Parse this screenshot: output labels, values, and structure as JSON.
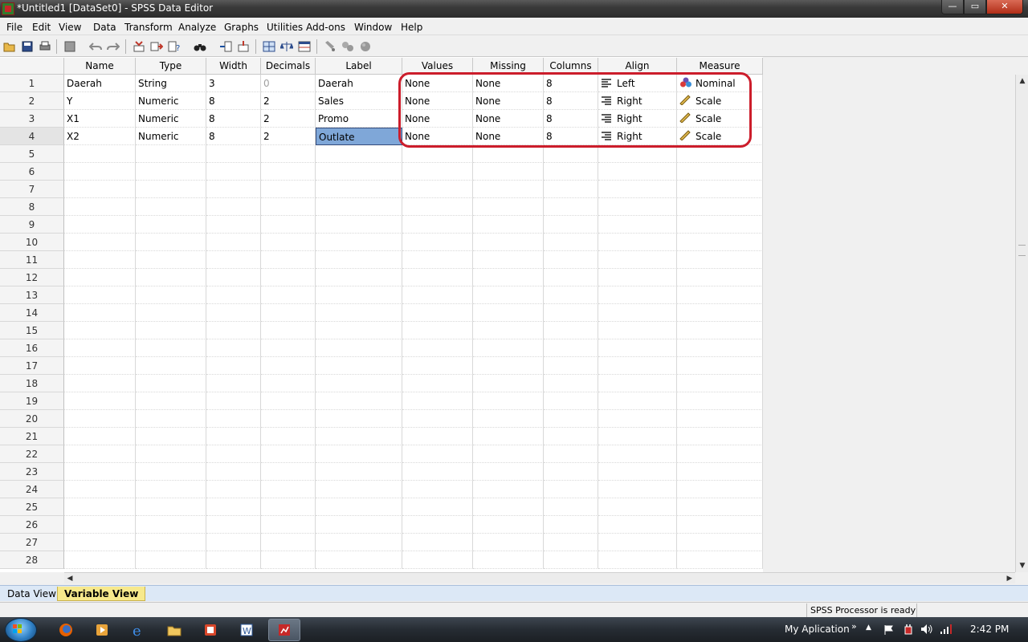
{
  "window": {
    "title": "*Untitled1 [DataSet0] - SPSS Data Editor",
    "controls": {
      "minimize": "—",
      "maximize": "▭",
      "close": "✕"
    }
  },
  "menu": [
    "File",
    "Edit",
    "View",
    "Data",
    "Transform",
    "Analyze",
    "Graphs",
    "Utilities",
    "Add-ons",
    "Window",
    "Help"
  ],
  "toolbar_icons": [
    "open-folder-icon",
    "save-icon",
    "print-icon",
    "dialog-recall-icon",
    "undo-icon",
    "redo-icon",
    "goto-case-icon",
    "goto-variable-icon",
    "variables-icon",
    "find-icon",
    "insert-cases-icon",
    "insert-variable-icon",
    "split-file-icon",
    "weight-cases-icon",
    "select-cases-icon",
    "value-labels-icon",
    "use-sets-icon",
    "show-all-variables-icon",
    "spell-check-icon"
  ],
  "grid": {
    "columns": [
      "Name",
      "Type",
      "Width",
      "Decimals",
      "Label",
      "Values",
      "Missing",
      "Columns",
      "Align",
      "Measure"
    ],
    "rows": [
      {
        "num": "1",
        "name": "Daerah",
        "type": "String",
        "width": "3",
        "decimals": "0",
        "label": "Daerah",
        "values": "None",
        "missing": "None",
        "columns": "8",
        "align": "Left",
        "align_icon": "align-left-icon",
        "measure": "Nominal",
        "measure_icon": "nominal-icon"
      },
      {
        "num": "2",
        "name": "Y",
        "type": "Numeric",
        "width": "8",
        "decimals": "2",
        "label": "Sales",
        "values": "None",
        "missing": "None",
        "columns": "8",
        "align": "Right",
        "align_icon": "align-right-icon",
        "measure": "Scale",
        "measure_icon": "scale-ruler-icon"
      },
      {
        "num": "3",
        "name": "X1",
        "type": "Numeric",
        "width": "8",
        "decimals": "2",
        "label": "Promo",
        "values": "None",
        "missing": "None",
        "columns": "8",
        "align": "Right",
        "align_icon": "align-right-icon",
        "measure": "Scale",
        "measure_icon": "scale-ruler-icon"
      },
      {
        "num": "4",
        "name": "X2",
        "type": "Numeric",
        "width": "8",
        "decimals": "2",
        "label": "Outlate",
        "values": "None",
        "missing": "None",
        "columns": "8",
        "align": "Right",
        "align_icon": "align-right-icon",
        "measure": "Scale",
        "measure_icon": "scale-ruler-icon"
      }
    ],
    "empty_row_numbers": [
      "5",
      "6",
      "7",
      "8",
      "9",
      "10",
      "11",
      "12",
      "13",
      "14",
      "15",
      "16",
      "17",
      "18",
      "19",
      "20",
      "21",
      "22",
      "23",
      "24",
      "25",
      "26",
      "27",
      "28"
    ],
    "selected_cell": "row 4, Label",
    "annotation_color": "#cc1d2b"
  },
  "tabs": [
    {
      "label": "Data View",
      "active": false
    },
    {
      "label": "Variable View",
      "active": true
    }
  ],
  "status": {
    "processor": "SPSS  Processor is ready"
  },
  "taskbar": {
    "apps": [
      "firefox-icon",
      "media-player-icon",
      "internet-explorer-icon",
      "file-explorer-icon",
      "pdf-app-icon",
      "word-icon",
      "spss-icon"
    ],
    "tray_label": "My Aplication",
    "tray_chevron": "»",
    "time": "2:42 PM"
  },
  "colors": {
    "accent_selected": "#7fa7d8",
    "tab_active": "#f7e98c",
    "highlight": "#cc1d2b"
  }
}
